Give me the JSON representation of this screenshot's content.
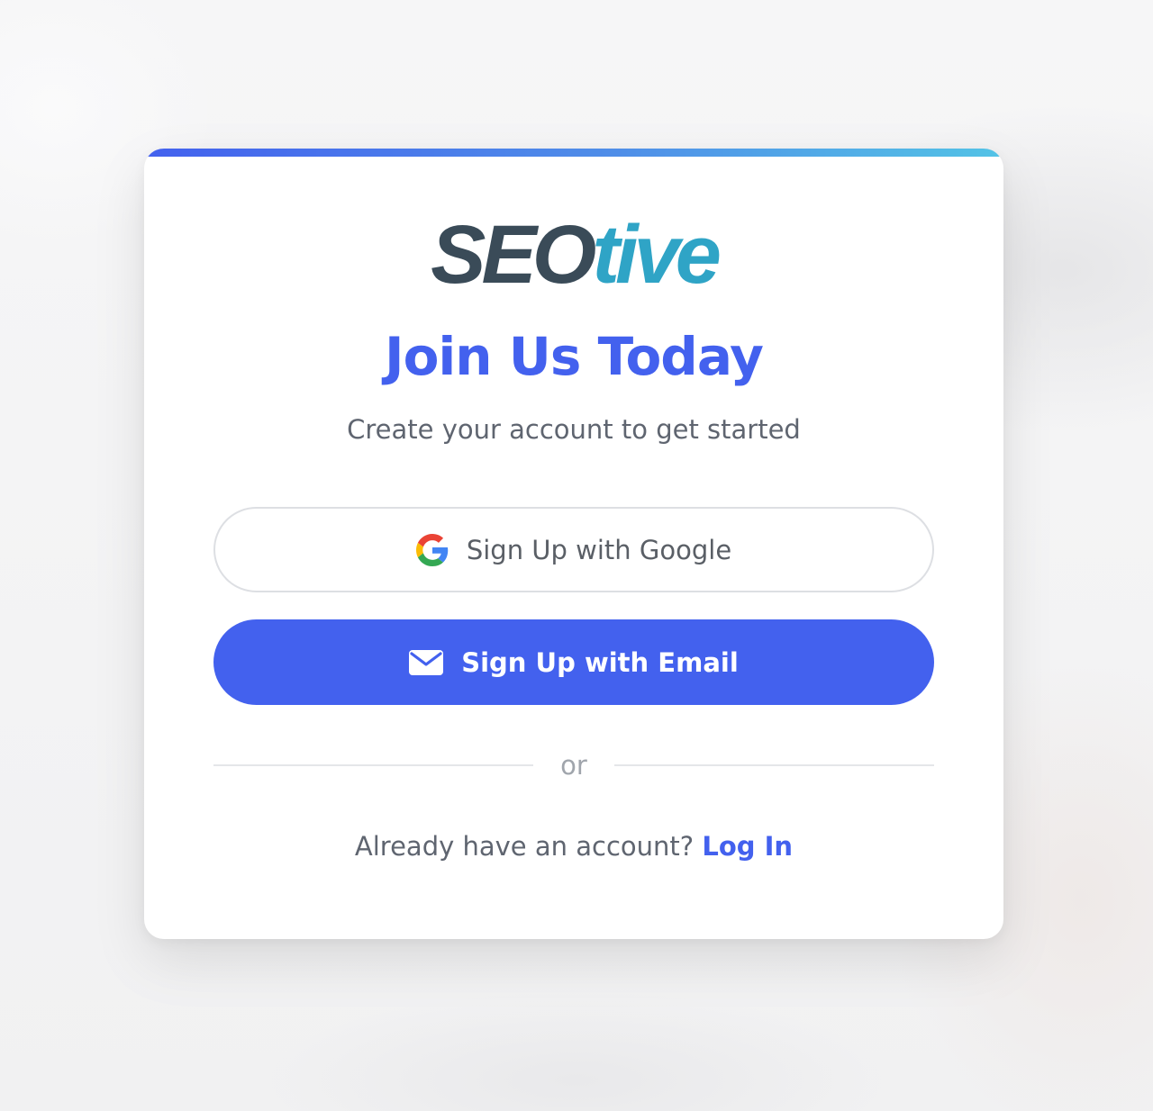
{
  "brand": {
    "logo_part1": "SEO",
    "logo_part2": "tive",
    "logo_dark_color": "#3a4b58",
    "logo_accent_color": "#2fa4c6"
  },
  "colors": {
    "primary": "#4361ee",
    "accent_gradient_start": "#4361ee",
    "accent_gradient_end": "#53c3e6",
    "text_muted": "#5f6570"
  },
  "signup": {
    "title": "Join Us Today",
    "subtitle": "Create your account to get started",
    "google_button_label": "Sign Up with Google",
    "google_icon": "google-g-icon",
    "email_button_label": "Sign Up with Email",
    "email_icon": "envelope-icon",
    "divider_text": "or",
    "login_prompt": "Already have an account?",
    "login_link": "Log In"
  }
}
